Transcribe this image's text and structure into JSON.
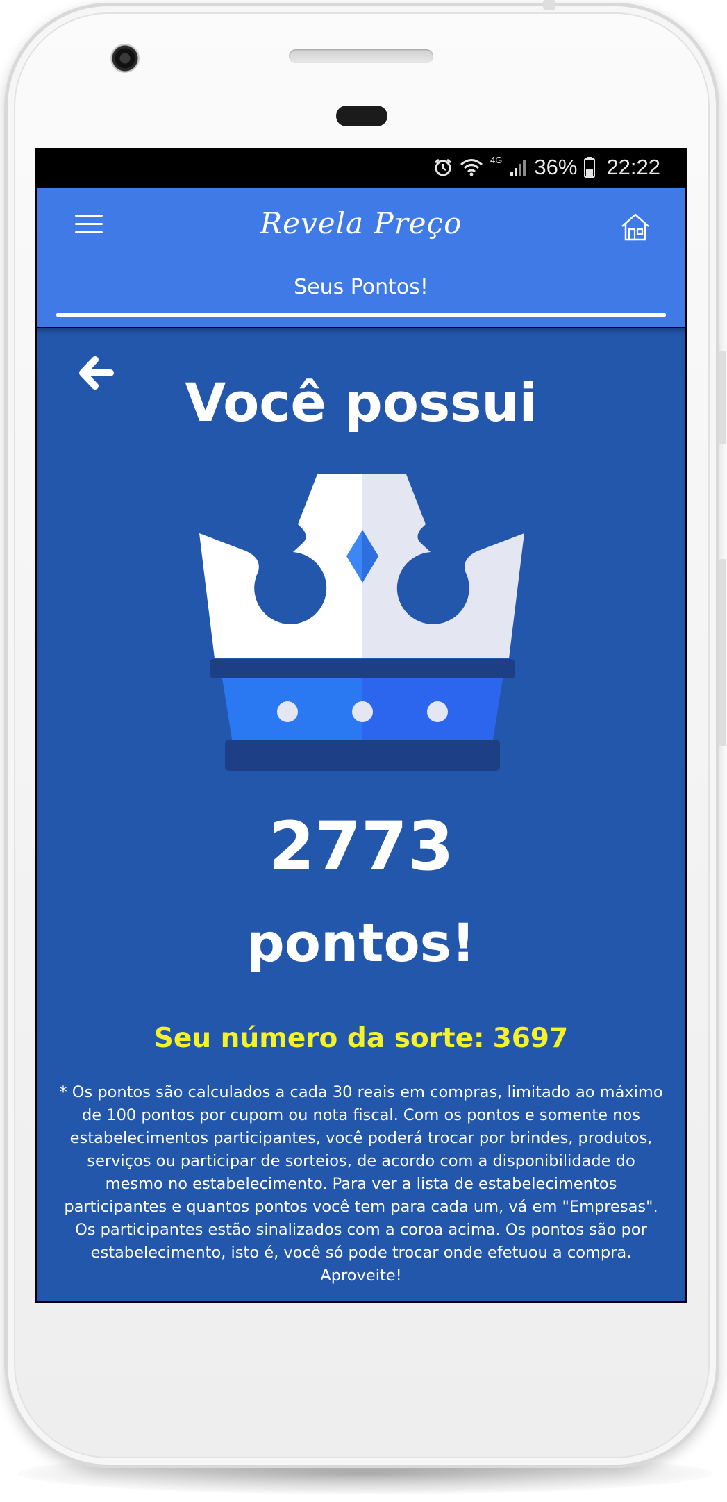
{
  "status_bar": {
    "network": "4G",
    "battery_percent": "36%",
    "time": "22:22",
    "icons": [
      "alarm-icon",
      "wifi-icon",
      "signal-icon",
      "battery-icon"
    ]
  },
  "app_bar": {
    "title": "Revela Preço",
    "menu_icon": "hamburger-menu-icon",
    "home_icon": "home-icon",
    "tab_label": "Seus Pontos!"
  },
  "main": {
    "back_icon": "arrow-left-icon",
    "heading": "Você possui",
    "crown_icon": "crown-icon",
    "points_value": "2773",
    "points_suffix": "pontos!",
    "lucky_label": "Seu número da sorte:",
    "lucky_number": "3697",
    "disclaimer": "* Os pontos são calculados a cada 30 reais em compras, limitado ao máximo de 100 pontos por cupom ou nota fiscal. Com os pontos e somente nos estabelecimentos participantes, você poderá trocar por brindes, produtos, serviços ou participar de sorteios, de acordo com a disponibilidade do mesmo no estabelecimento. Para ver a lista de estabelecimentos participantes e quantos pontos você tem para cada um, vá em \"Empresas\". Os participantes estão sinalizados com a coroa acima. Os pontos são por estabelecimento, isto é, você só pode trocar onde efetuou a compra. Aproveite!"
  },
  "colors": {
    "app_bar": "#3f7ae6",
    "content_background": "#2257ab",
    "lucky_text": "#f5f22a",
    "crown_white": "#ffffff",
    "crown_band": "#2b74f0",
    "crown_dark": "#1d3f86"
  }
}
